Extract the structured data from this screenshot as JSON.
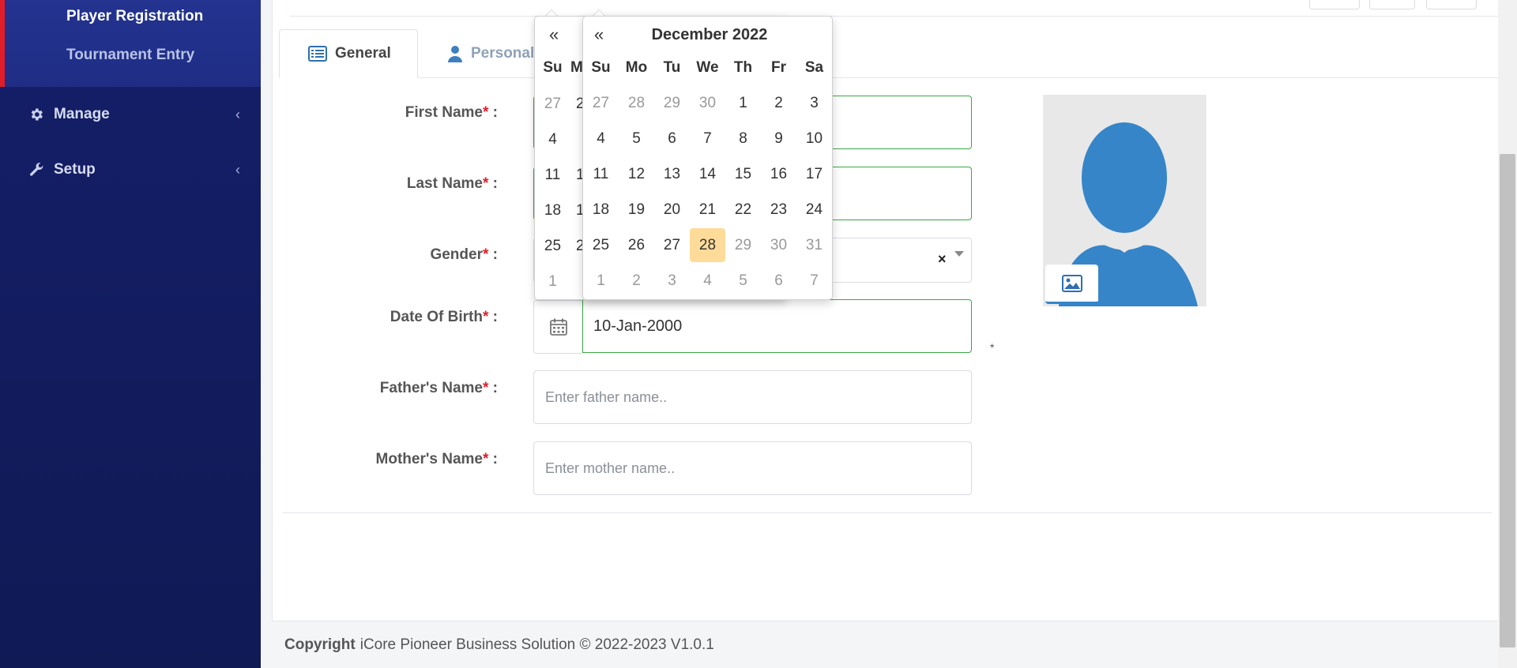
{
  "sidebar": {
    "sub_items": [
      "Player Registration",
      "Tournament Entry"
    ],
    "nav": [
      {
        "label": "Manage",
        "icon": "gear-icon"
      },
      {
        "label": "Setup",
        "icon": "wrench-icon"
      }
    ]
  },
  "tabs": [
    {
      "label": "General",
      "icon": "list-icon",
      "active": true
    },
    {
      "label": "Personal",
      "icon": "user-icon",
      "active": false
    }
  ],
  "form": {
    "required_mark": "*",
    "colon": " :",
    "first_name": {
      "label": "First Name"
    },
    "last_name": {
      "label": "Last Name"
    },
    "gender": {
      "label": "Gender",
      "clear": "×"
    },
    "dob": {
      "label": "Date Of Birth",
      "value": "10-Jan-2000"
    },
    "father_name": {
      "label": "Father's Name",
      "placeholder": "Enter father name.."
    },
    "mother_name": {
      "label": "Mother's Name",
      "placeholder": "Enter mother name.."
    },
    "photo_note": "*"
  },
  "datepicker": {
    "prev": "«",
    "title": "December 2022",
    "weekdays": [
      "Su",
      "Mo",
      "Tu",
      "We",
      "Th",
      "Fr",
      "Sa"
    ],
    "weeks": [
      [
        {
          "d": "27",
          "t": "old"
        },
        {
          "d": "28",
          "t": "old"
        },
        {
          "d": "29",
          "t": "old"
        },
        {
          "d": "30",
          "t": "old"
        },
        {
          "d": "1",
          "t": "cur"
        },
        {
          "d": "2",
          "t": "cur"
        },
        {
          "d": "3",
          "t": "cur"
        }
      ],
      [
        {
          "d": "4",
          "t": "cur"
        },
        {
          "d": "5",
          "t": "cur"
        },
        {
          "d": "6",
          "t": "cur"
        },
        {
          "d": "7",
          "t": "cur"
        },
        {
          "d": "8",
          "t": "cur"
        },
        {
          "d": "9",
          "t": "cur"
        },
        {
          "d": "10",
          "t": "cur"
        }
      ],
      [
        {
          "d": "11",
          "t": "cur"
        },
        {
          "d": "12",
          "t": "cur"
        },
        {
          "d": "13",
          "t": "cur"
        },
        {
          "d": "14",
          "t": "cur"
        },
        {
          "d": "15",
          "t": "cur"
        },
        {
          "d": "16",
          "t": "cur"
        },
        {
          "d": "17",
          "t": "cur"
        }
      ],
      [
        {
          "d": "18",
          "t": "cur"
        },
        {
          "d": "19",
          "t": "cur"
        },
        {
          "d": "20",
          "t": "cur"
        },
        {
          "d": "21",
          "t": "cur"
        },
        {
          "d": "22",
          "t": "cur"
        },
        {
          "d": "23",
          "t": "cur"
        },
        {
          "d": "24",
          "t": "cur"
        }
      ],
      [
        {
          "d": "25",
          "t": "cur"
        },
        {
          "d": "26",
          "t": "cur"
        },
        {
          "d": "27",
          "t": "cur"
        },
        {
          "d": "28",
          "t": "active"
        },
        {
          "d": "29",
          "t": "new"
        },
        {
          "d": "30",
          "t": "new"
        },
        {
          "d": "31",
          "t": "new"
        }
      ],
      [
        {
          "d": "1",
          "t": "new"
        },
        {
          "d": "2",
          "t": "new"
        },
        {
          "d": "3",
          "t": "new"
        },
        {
          "d": "4",
          "t": "new"
        },
        {
          "d": "5",
          "t": "new"
        },
        {
          "d": "6",
          "t": "new"
        },
        {
          "d": "7",
          "t": "new"
        }
      ]
    ],
    "back_layer": {
      "prev": "«",
      "header": "Su",
      "partial_header": "M",
      "column": [
        {
          "d": "27",
          "t": "old"
        },
        {
          "d": "4",
          "t": "cur"
        },
        {
          "d": "11",
          "t": "cur"
        },
        {
          "d": "18",
          "t": "cur"
        },
        {
          "d": "25",
          "t": "cur"
        },
        {
          "d": "1",
          "t": "new"
        }
      ],
      "partial_column": [
        "2",
        "",
        "1",
        "1",
        "2",
        ""
      ]
    }
  },
  "footer": {
    "bold": "Copyright",
    "text": "iCore Pioneer Business Solution © 2022-2023 V1.0.1"
  },
  "colors": {
    "sidebar_bg": "#141e66",
    "accent_red": "#e11d2a",
    "valid_green": "#3aa845",
    "active_day": "#ffdb99",
    "avatar_blue": "#3585c8"
  }
}
